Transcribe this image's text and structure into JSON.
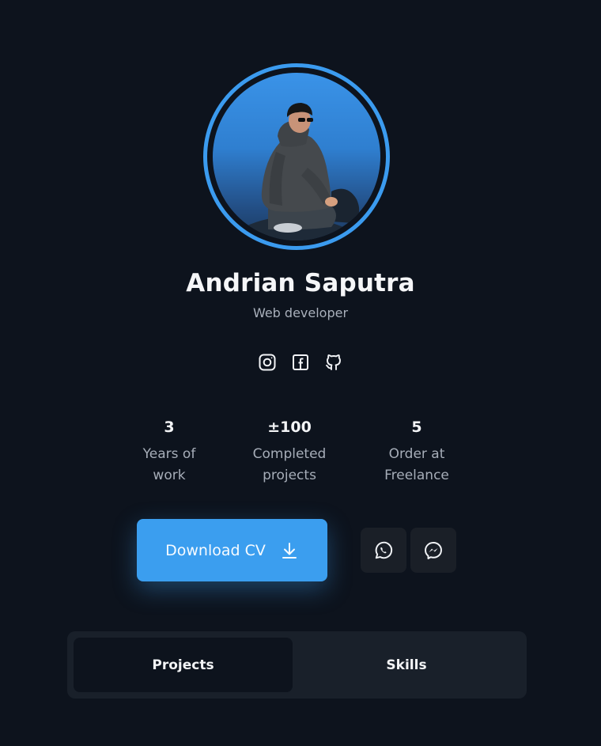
{
  "profile": {
    "name": "Andrian Saputra",
    "role": "Web developer",
    "avatar_icon": "profile-photo",
    "ring_color": "#3b9bef"
  },
  "socials": [
    {
      "icon": "instagram-icon"
    },
    {
      "icon": "facebook-icon"
    },
    {
      "icon": "github-icon"
    }
  ],
  "stats": [
    {
      "value": "3",
      "label": "Years of\nwork"
    },
    {
      "value": "±100",
      "label": "Completed\nprojects"
    },
    {
      "value": "5",
      "label": "Order at\nFreelance"
    }
  ],
  "actions": {
    "download_label": "Download CV",
    "download_icon": "download-icon",
    "whatsapp_icon": "whatsapp-icon",
    "messenger_icon": "messenger-icon",
    "accent_color": "#3b9eef"
  },
  "tabs": [
    {
      "label": "Projects",
      "active": true
    },
    {
      "label": "Skills",
      "active": false
    }
  ]
}
